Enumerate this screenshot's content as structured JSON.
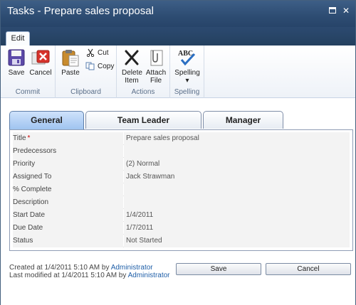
{
  "window": {
    "title": "Tasks - Prepare sales proposal",
    "maximize_label": "",
    "close_label": "✕"
  },
  "ribbon": {
    "tab": "Edit",
    "groups": {
      "commit": {
        "label": "Commit",
        "save": "Save",
        "cancel": "Cancel"
      },
      "clipboard": {
        "label": "Clipboard",
        "paste": "Paste",
        "cut": "Cut",
        "copy": "Copy"
      },
      "actions": {
        "label": "Actions",
        "delete_item_1": "Delete",
        "delete_item_2": "Item",
        "attach_file_1": "Attach",
        "attach_file_2": "File"
      },
      "spelling": {
        "label": "Spelling",
        "spelling": "Spelling",
        "abc": "ABC"
      }
    }
  },
  "form_tabs": [
    "General",
    "Team Leader",
    "Manager"
  ],
  "fields": [
    {
      "label": "Title",
      "required": true,
      "value": "Prepare sales proposal"
    },
    {
      "label": "Predecessors",
      "value": ""
    },
    {
      "label": "Priority",
      "value": "(2) Normal"
    },
    {
      "label": "Assigned To",
      "value": "Jack Strawman",
      "link": true
    },
    {
      "label": "% Complete",
      "value": ""
    },
    {
      "label": "Description",
      "value": ""
    },
    {
      "label": "Start Date",
      "value": "1/4/2011"
    },
    {
      "label": "Due Date",
      "value": "1/7/2011"
    },
    {
      "label": "Status",
      "value": "Not Started"
    }
  ],
  "footer": {
    "created_prefix": "Created at 1/4/2011 5:10 AM by ",
    "created_by": "Administrator",
    "modified_prefix": "Last modified at 1/4/2011 5:10 AM by ",
    "modified_by": "Administrator",
    "save_button": "Save",
    "cancel_button": "Cancel"
  },
  "colors": {
    "title_bar": "#2d4c72",
    "active_tab": "#9fc4f0",
    "link": "#1f5fa8",
    "required": "#cc0000"
  },
  "icons": [
    "save-icon",
    "cancel-icon",
    "paste-icon",
    "cut-icon",
    "copy-icon",
    "delete-item-icon",
    "attach-file-icon",
    "spelling-icon"
  ]
}
